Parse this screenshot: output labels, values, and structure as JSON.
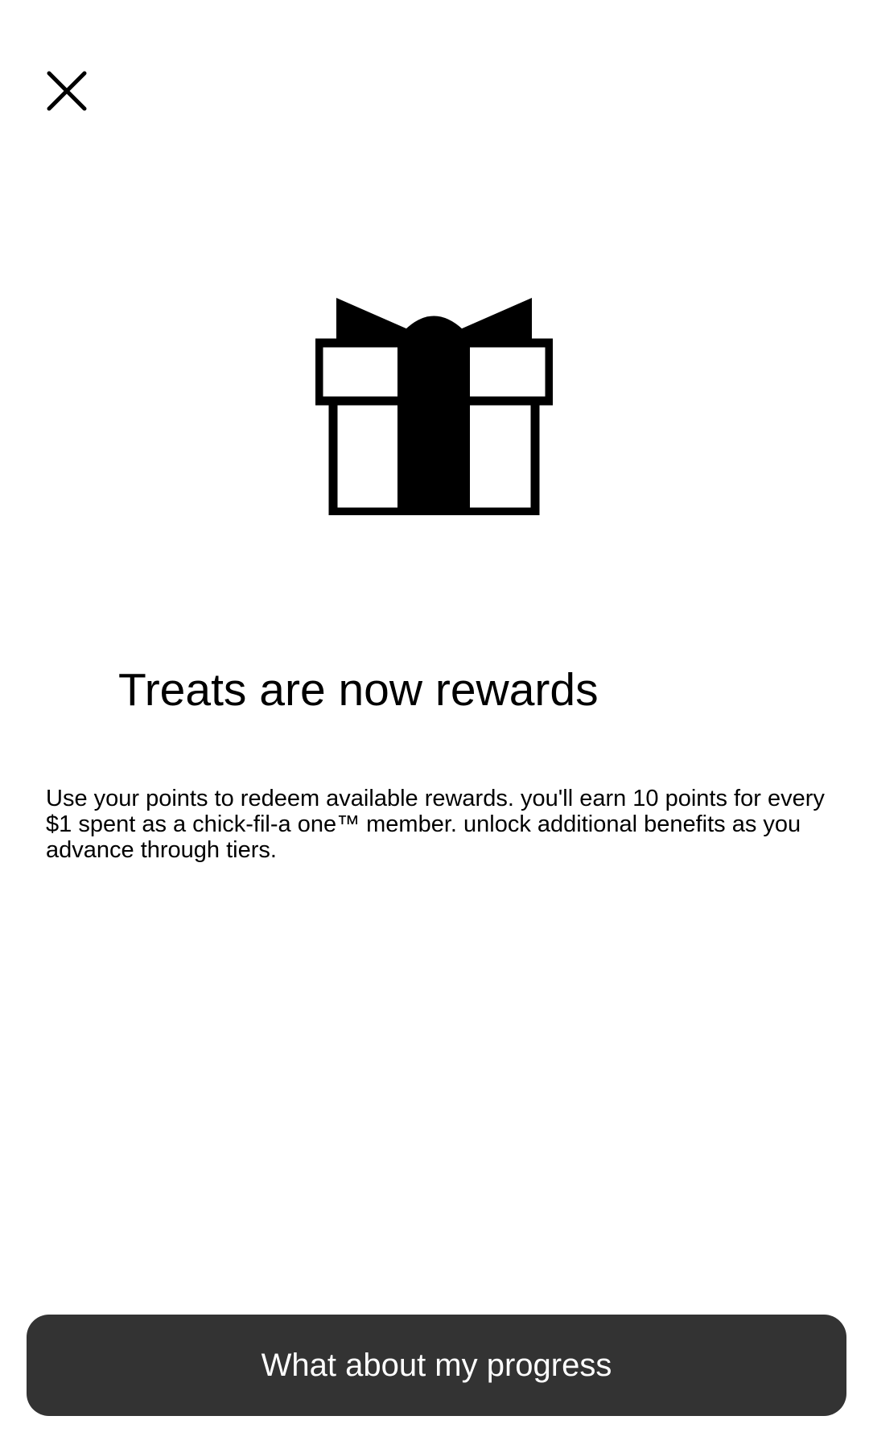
{
  "header": {
    "close_icon": "close-icon"
  },
  "hero": {
    "icon": "gift-icon",
    "title": "Treats are now rewards",
    "description": "Use your points to redeem available rewards. you'll earn 10 points for every $1 spent as a chick-fil-a one™ member. unlock additional benefits as you advance through tiers."
  },
  "footer": {
    "button_label": "What about my progress"
  },
  "colors": {
    "button_background": "#333333",
    "button_text": "#ffffff",
    "icon": "#000000"
  }
}
